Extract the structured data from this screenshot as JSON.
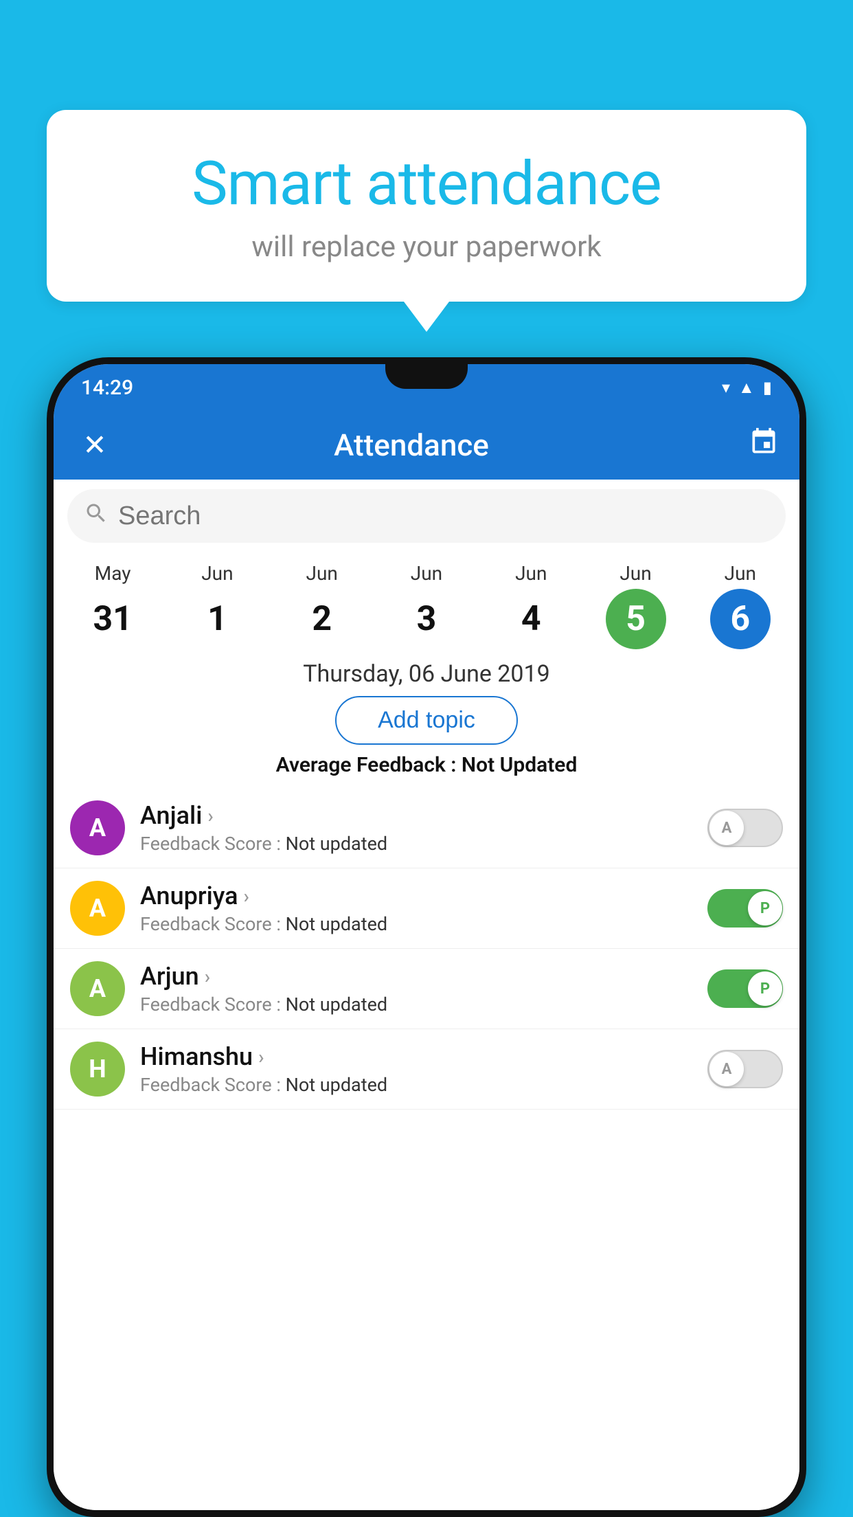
{
  "background_color": "#1ab9e8",
  "speech_bubble": {
    "title": "Smart attendance",
    "subtitle": "will replace your paperwork"
  },
  "status_bar": {
    "time": "14:29",
    "wifi_icon": "▾",
    "signal_icon": "▲",
    "battery_icon": "▮"
  },
  "app_bar": {
    "close_label": "✕",
    "title": "Attendance",
    "calendar_icon": "📅"
  },
  "search": {
    "placeholder": "Search"
  },
  "calendar": {
    "days": [
      {
        "month": "May",
        "date": "31",
        "state": "normal"
      },
      {
        "month": "Jun",
        "date": "1",
        "state": "normal"
      },
      {
        "month": "Jun",
        "date": "2",
        "state": "normal"
      },
      {
        "month": "Jun",
        "date": "3",
        "state": "normal"
      },
      {
        "month": "Jun",
        "date": "4",
        "state": "normal"
      },
      {
        "month": "Jun",
        "date": "5",
        "state": "today"
      },
      {
        "month": "Jun",
        "date": "6",
        "state": "selected"
      }
    ],
    "selected_date_label": "Thursday, 06 June 2019"
  },
  "add_topic_label": "Add topic",
  "avg_feedback_label": "Average Feedback :",
  "avg_feedback_value": "Not Updated",
  "students": [
    {
      "name": "Anjali",
      "avatar_letter": "A",
      "avatar_color": "#9c27b0",
      "feedback_label": "Feedback Score :",
      "feedback_value": "Not updated",
      "toggle_state": "off",
      "toggle_label": "A"
    },
    {
      "name": "Anupriya",
      "avatar_letter": "A",
      "avatar_color": "#ffc107",
      "feedback_label": "Feedback Score :",
      "feedback_value": "Not updated",
      "toggle_state": "on",
      "toggle_label": "P"
    },
    {
      "name": "Arjun",
      "avatar_letter": "A",
      "avatar_color": "#8bc34a",
      "feedback_label": "Feedback Score :",
      "feedback_value": "Not updated",
      "toggle_state": "on",
      "toggle_label": "P"
    },
    {
      "name": "Himanshu",
      "avatar_letter": "H",
      "avatar_color": "#8bc34a",
      "feedback_label": "Feedback Score :",
      "feedback_value": "Not updated",
      "toggle_state": "off",
      "toggle_label": "A"
    }
  ]
}
